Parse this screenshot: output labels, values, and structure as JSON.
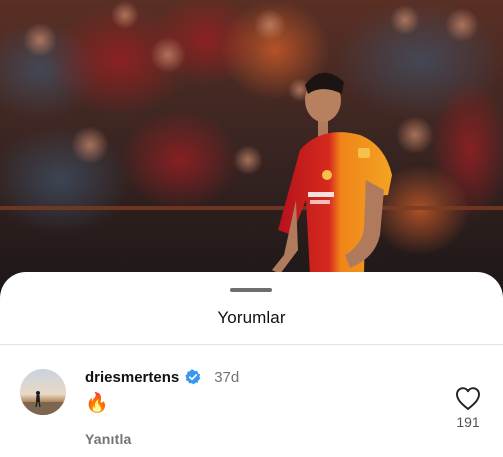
{
  "sheet": {
    "title": "Yorumlar"
  },
  "comment": {
    "username": "driesmertens",
    "verified": true,
    "verified_icon": "verified-badge-icon",
    "timestamp": "37d",
    "text": "🔥",
    "reply_label": "Yanıtla",
    "like_icon": "heart-outline-icon",
    "like_count": "191"
  },
  "colors": {
    "sheet_background": "#ffffff",
    "verified_blue": "#3897f0",
    "secondary_text": "#737373",
    "jersey_red": "#c8102e",
    "jersey_orange": "#f39200"
  }
}
